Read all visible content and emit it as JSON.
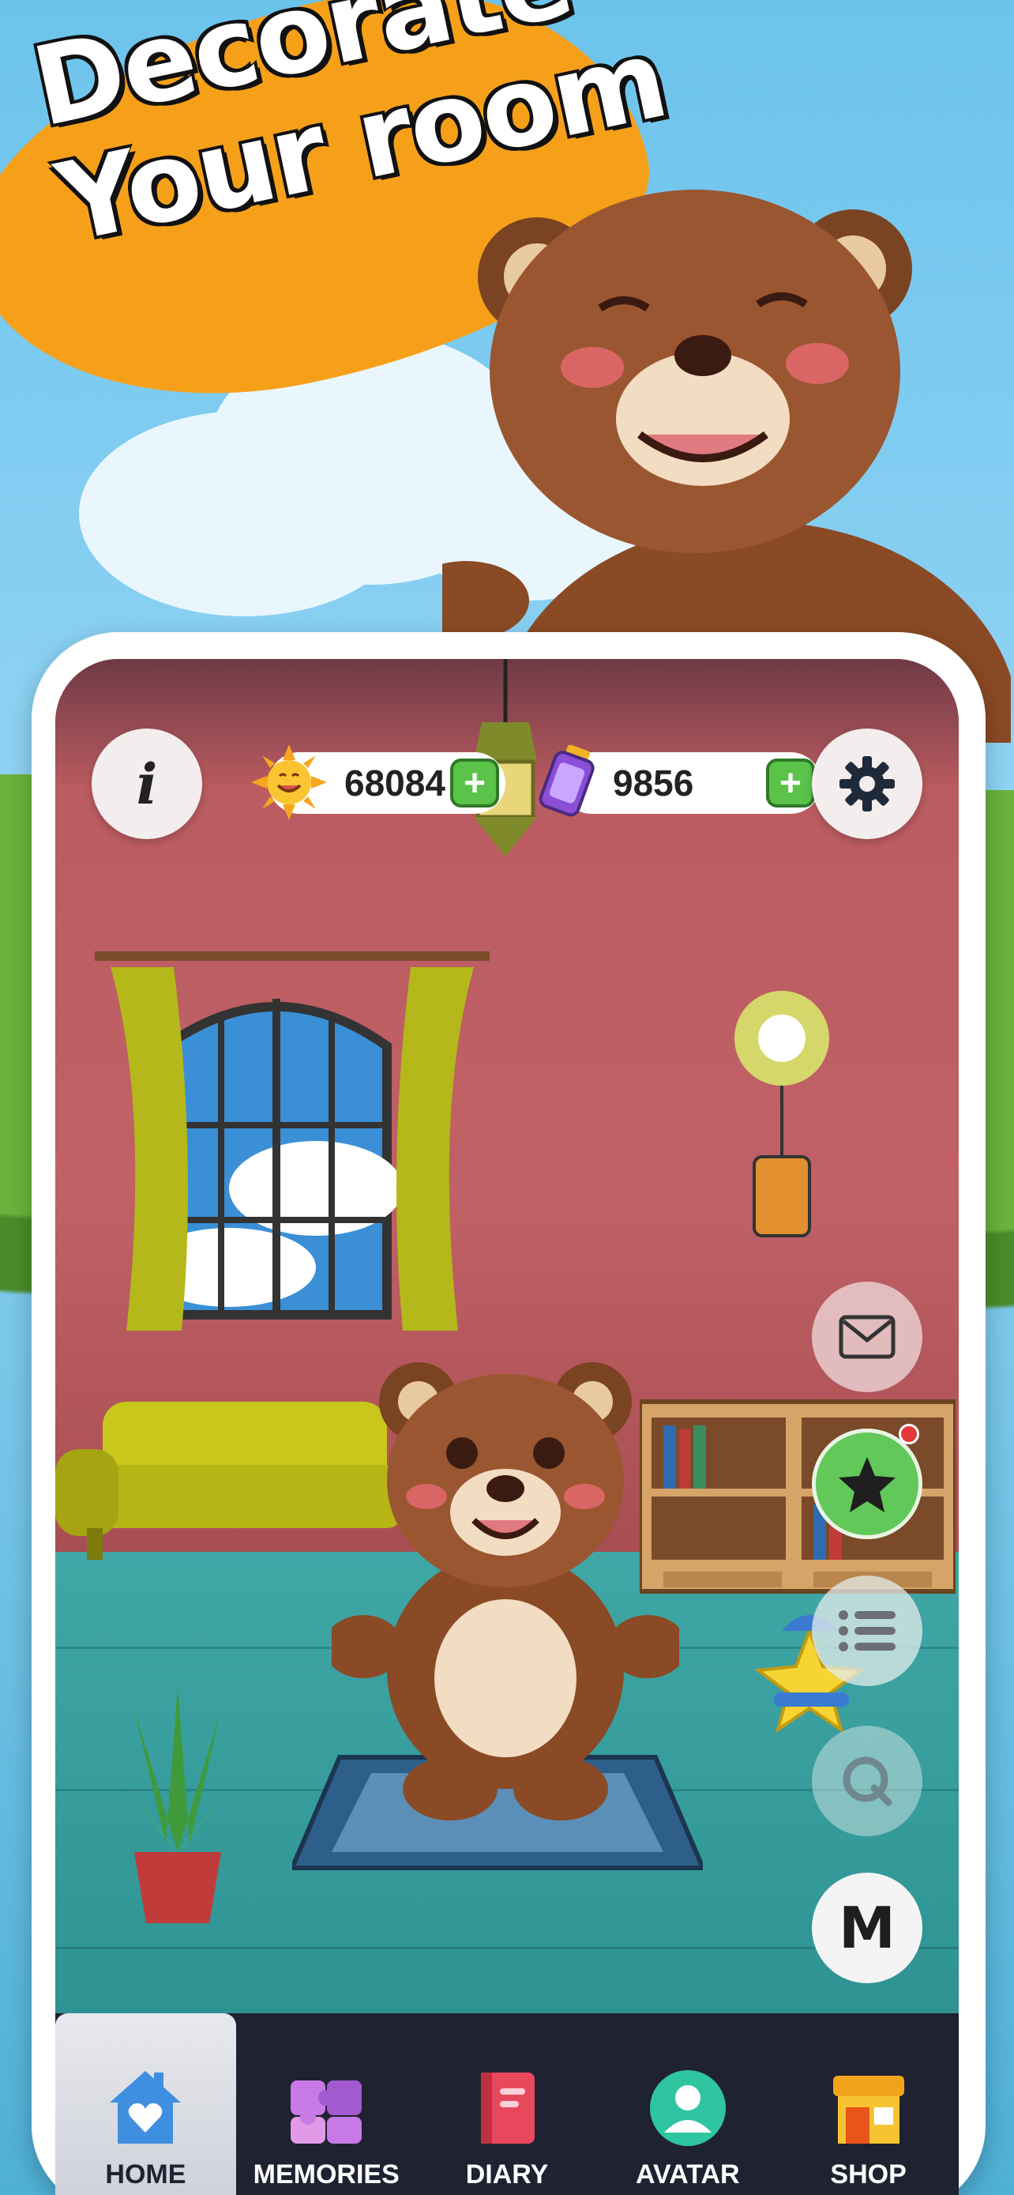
{
  "promo": {
    "line1": "Decorate",
    "line2": "Your room"
  },
  "top_bar": {
    "sun_currency": "68084",
    "potion_currency": "9856",
    "info_glyph": "i"
  },
  "side_buttons": {
    "m_label": "M"
  },
  "bottom_nav": {
    "items": [
      {
        "label": "HOME",
        "icon": "house-heart-icon",
        "active": true
      },
      {
        "label": "MEMORIES",
        "icon": "puzzle-icon",
        "active": false
      },
      {
        "label": "DIARY",
        "icon": "book-icon",
        "active": false
      },
      {
        "label": "AVATAR",
        "icon": "person-icon",
        "active": false
      },
      {
        "label": "SHOP",
        "icon": "shop-icon",
        "active": false
      }
    ]
  },
  "colors": {
    "promo_orange": "#f6a01a",
    "wall": "#b85a5f",
    "floor": "#3fa7a6",
    "accent_green": "#5bc24a",
    "nav_bg": "#1f2230"
  }
}
